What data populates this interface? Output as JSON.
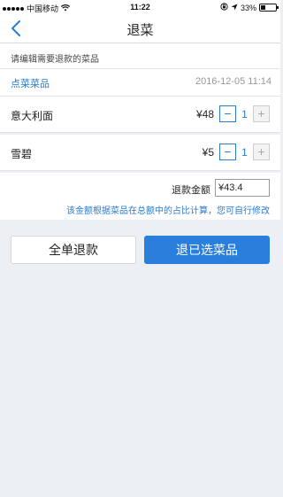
{
  "status_bar": {
    "carrier": "中国移动",
    "time": "11:22",
    "battery": "33%",
    "battery_level": 0.33
  },
  "nav": {
    "title": "退菜"
  },
  "hint": "请编辑需要退款的菜品",
  "order": {
    "label": "点菜菜品",
    "time": "2016-12-05 11:14"
  },
  "dishes": [
    {
      "name": "意大利面",
      "price": "¥48",
      "qty": "1",
      "minus": "−",
      "plus": "+"
    },
    {
      "name": "雪碧",
      "price": "¥5",
      "qty": "1",
      "minus": "−",
      "plus": "+"
    }
  ],
  "refund": {
    "label": "退款金额",
    "value": "¥43.4",
    "note": "该金额根据菜品在总额中的占比计算，您可自行修改"
  },
  "buttons": {
    "full_refund": "全单退款",
    "refund_selected": "退已选菜品"
  },
  "colors": {
    "accent": "#2b7fdc",
    "background": "#eceff3"
  },
  "icons": [
    "signal-icon",
    "wifi-icon",
    "lock-rotation-icon",
    "location-arrow-icon",
    "battery-icon",
    "back-chevron-icon"
  ]
}
